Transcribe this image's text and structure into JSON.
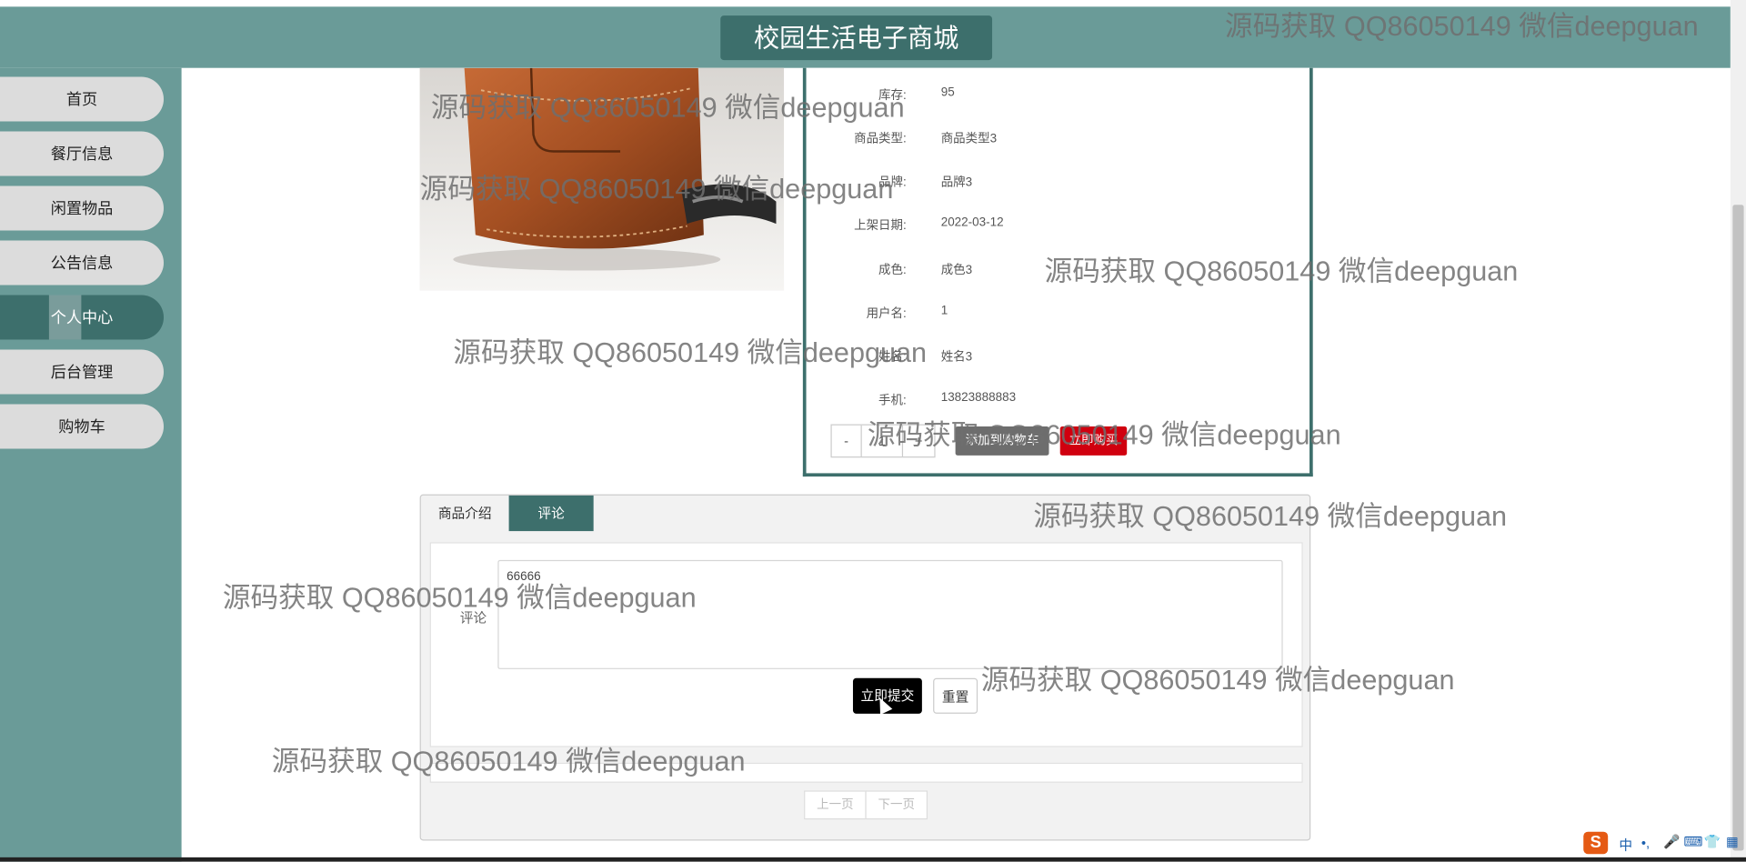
{
  "header": {
    "title": "校园生活电子商城"
  },
  "sidebar": {
    "items": [
      {
        "label": "首页"
      },
      {
        "label": "餐厅信息"
      },
      {
        "label": "闲置物品"
      },
      {
        "label": "公告信息"
      },
      {
        "label": "个人中心",
        "active": true
      },
      {
        "label": "后台管理"
      },
      {
        "label": "购物车"
      }
    ]
  },
  "product": {
    "image_alt": "brown leather bag",
    "fields": [
      {
        "key": "库存:",
        "value": "95"
      },
      {
        "key": "商品类型:",
        "value": "商品类型3"
      },
      {
        "key": "品牌:",
        "value": "品牌3"
      },
      {
        "key": "上架日期:",
        "value": "2022-03-12"
      },
      {
        "key": "成色:",
        "value": "成色3"
      },
      {
        "key": "用户名:",
        "value": "1"
      },
      {
        "key": "姓名:",
        "value": "姓名3"
      },
      {
        "key": "手机:",
        "value": "13823888883"
      }
    ],
    "quantity": {
      "minus": "-",
      "value": "1",
      "plus": "+"
    },
    "add_to_cart_label": "添加到购物车",
    "buy_now_label": "立即购买"
  },
  "tabs": [
    {
      "label": "商品介绍",
      "active": false
    },
    {
      "label": "评论",
      "active": true
    }
  ],
  "comment_form": {
    "label": "评论",
    "value": "66666",
    "submit_label": "立即提交",
    "reset_label": "重置"
  },
  "pagination": {
    "prev_label": "上一页",
    "next_label": "下一页"
  },
  "watermark": {
    "text": "源码获取 QQ86050149 微信deepguan"
  },
  "tray": {
    "lang": "中"
  },
  "colors": {
    "theme": "#6a9b98",
    "theme_dark": "#3d6f6c",
    "nav_item": "#dcdcdc",
    "buy_button": "#d0000f",
    "cart_button": "#6d6d6d"
  }
}
